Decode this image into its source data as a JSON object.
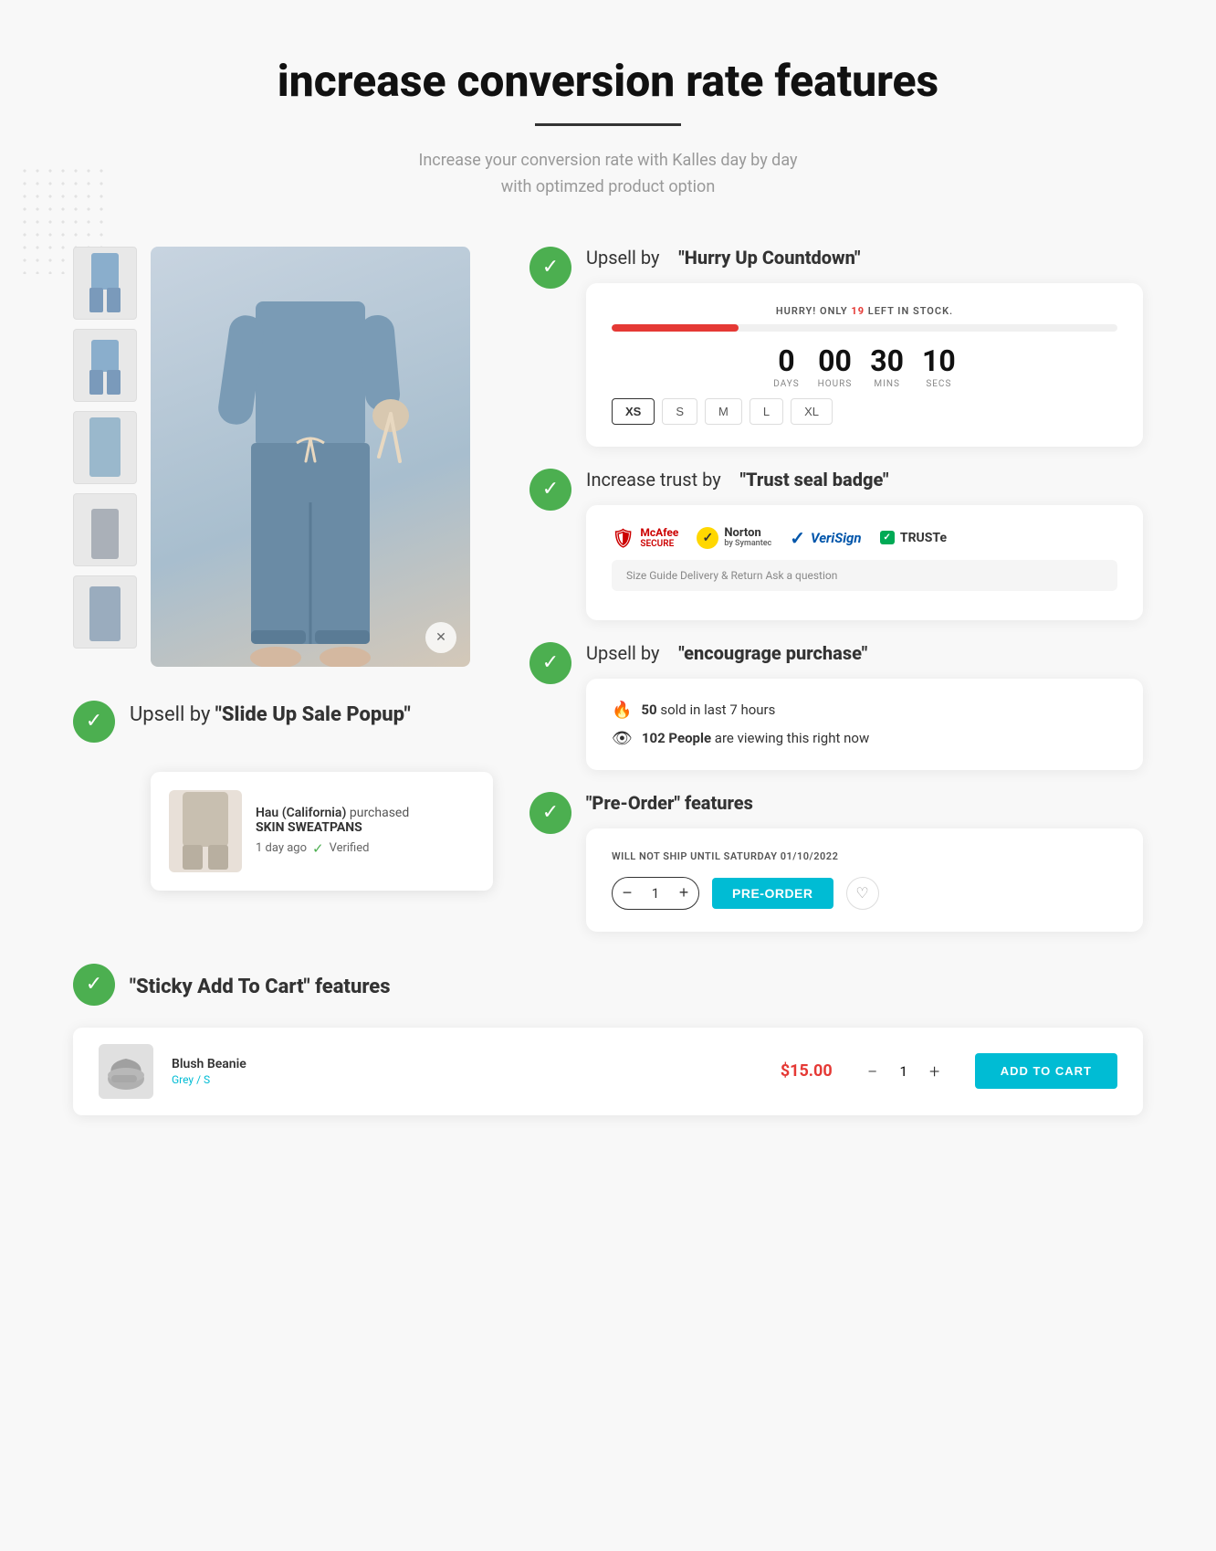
{
  "page": {
    "title": "increase conversion rate features",
    "divider": true,
    "subtitle_line1": "Increase your conversion rate with Kalles  day by day",
    "subtitle_line2": "with optimzed product option"
  },
  "features": {
    "hurry_countdown": {
      "badge_check": "✓",
      "label": "Upsell by",
      "title_suffix": "\"Hurry Up Countdown\"",
      "hurry_text_prefix": "HURRY! ONLY ",
      "hurry_stock_num": "19",
      "hurry_text_suffix": " LEFT IN STOCK.",
      "countdown": {
        "days": "0",
        "days_label": "DAYS",
        "hours": "00",
        "hours_label": "HOURS",
        "mins": "30",
        "mins_label": "MINS",
        "secs": "10",
        "secs_label": "SECS"
      },
      "sizes": [
        "XS",
        "S",
        "M",
        "L",
        "XL"
      ]
    },
    "trust_badge": {
      "badge_check": "✓",
      "label": "Increase trust by",
      "title_suffix": "\"Trust seal badge\"",
      "badges": [
        {
          "name": "McAfee SECURE",
          "icon": "🛡",
          "color": "#cc0000"
        },
        {
          "name": "Norton",
          "icon": "✓",
          "color": "#ffd700"
        },
        {
          "name": "VeriSign",
          "icon": "✓",
          "color": "#0055aa"
        },
        {
          "name": "TRUSTe",
          "icon": "✓",
          "color": "#00aa55"
        }
      ],
      "info_text": "Size Guide   Delivery & Return   Ask a question"
    },
    "encourage_purchase": {
      "badge_check": "✓",
      "label": "Upsell by",
      "title_suffix": "\"encougrage purchase\"",
      "items": [
        {
          "icon": "🔥",
          "text_prefix": "",
          "number": "50",
          "text_suffix": " sold in last 7 hours"
        },
        {
          "icon": "👁",
          "text_prefix": "",
          "number": "102",
          "text_bold": " People",
          "text_suffix": " are viewing this right now"
        }
      ]
    },
    "preorder": {
      "badge_check": "✓",
      "label_prefix": "",
      "title": "\"Pre-Order\" features",
      "ship_text": "WILL NOT SHIP UNTIL SATURDAY 01/10/2022",
      "qty_minus": "−",
      "qty_value": "1",
      "qty_plus": "+",
      "preorder_btn": "PRE-ORDER",
      "wishlist_icon": "♡"
    },
    "slide_up_popup": {
      "badge_check": "✓",
      "label_prefix": "Upsell by ",
      "title": "\"Slide Up Sale Popup\"",
      "customer_name": "Hau (California)",
      "action": "purchased",
      "product_name": "SKIN SWEATPANS",
      "time_ago": "1 day ago",
      "verified": "Verified",
      "verified_icon": "✓"
    },
    "sticky_cart": {
      "badge_check": "✓",
      "label": "\"Sticky Add To Cart\" features",
      "product_name": "Blush Beanie",
      "product_variant": "Grey / S",
      "price": "$15.00",
      "qty_minus": "−",
      "qty_value": "1",
      "qty_plus": "+",
      "add_to_cart": "ADD TO CART"
    }
  },
  "colors": {
    "green": "#4caf50",
    "red": "#e53935",
    "cyan": "#00bcd4",
    "dark": "#111111",
    "gray": "#888888"
  }
}
